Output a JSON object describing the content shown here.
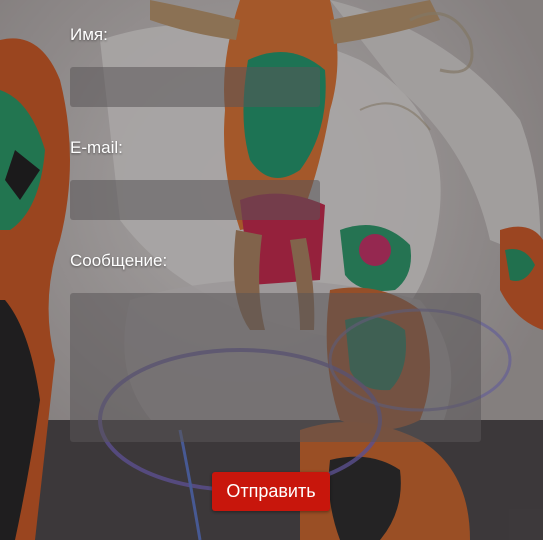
{
  "form": {
    "name_label": "Имя:",
    "name_value": "",
    "email_label": "E-mail:",
    "email_value": "",
    "message_label": "Сообщение:",
    "message_value": "",
    "submit_label": "Отправить"
  },
  "background": {
    "image": "performers-in-colorful-costumes-photo"
  },
  "colors": {
    "submit_button": "#c8160c",
    "label_text": "#ffffff",
    "field_background": "#5a5658"
  }
}
